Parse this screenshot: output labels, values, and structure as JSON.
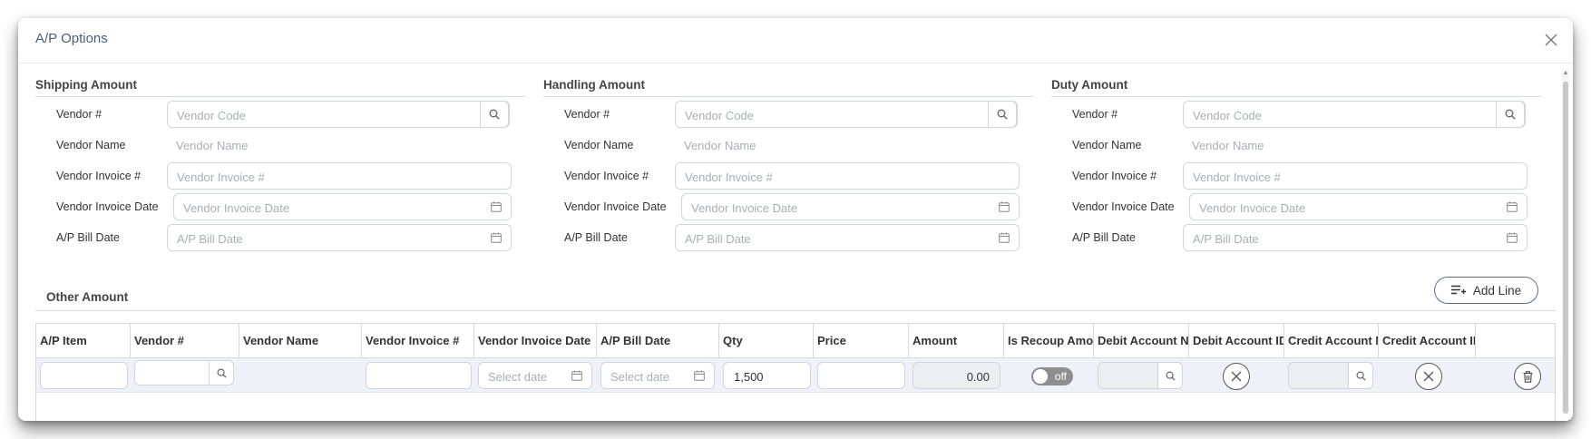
{
  "modal": {
    "title": "A/P Options"
  },
  "sections": [
    {
      "title": "Shipping Amount"
    },
    {
      "title": "Handling Amount"
    },
    {
      "title": "Duty Amount"
    }
  ],
  "form": {
    "vendor_label": "Vendor #",
    "vendor_placeholder": "Vendor Code",
    "vendor_name_label": "Vendor Name",
    "vendor_name_placeholder": "Vendor Name",
    "vendor_invoice_label": "Vendor Invoice #",
    "vendor_invoice_placeholder": "Vendor Invoice #",
    "vendor_invoice_date_label": "Vendor Invoice Date",
    "vendor_invoice_date_placeholder": "Vendor Invoice Date",
    "ap_bill_date_label": "A/P Bill Date",
    "ap_bill_date_placeholder": "A/P Bill Date"
  },
  "other": {
    "title": "Other Amount",
    "add_line_label": "Add Line"
  },
  "grid": {
    "columns": [
      "A/P Item",
      "Vendor #",
      "Vendor Name",
      "Vendor Invoice #",
      "Vendor Invoice Date",
      "A/P Bill Date",
      "Qty",
      "Price",
      "Amount",
      "Is Recoup Amount",
      "Debit Account Name",
      "Debit Account ID",
      "Credit Account Name",
      "Credit Account ID",
      ""
    ],
    "row": {
      "vendor_invoice_date_placeholder": "Select date",
      "ap_bill_date_placeholder": "Select date",
      "qty": "1,500",
      "amount": "0.00",
      "is_recoup": "off"
    }
  }
}
